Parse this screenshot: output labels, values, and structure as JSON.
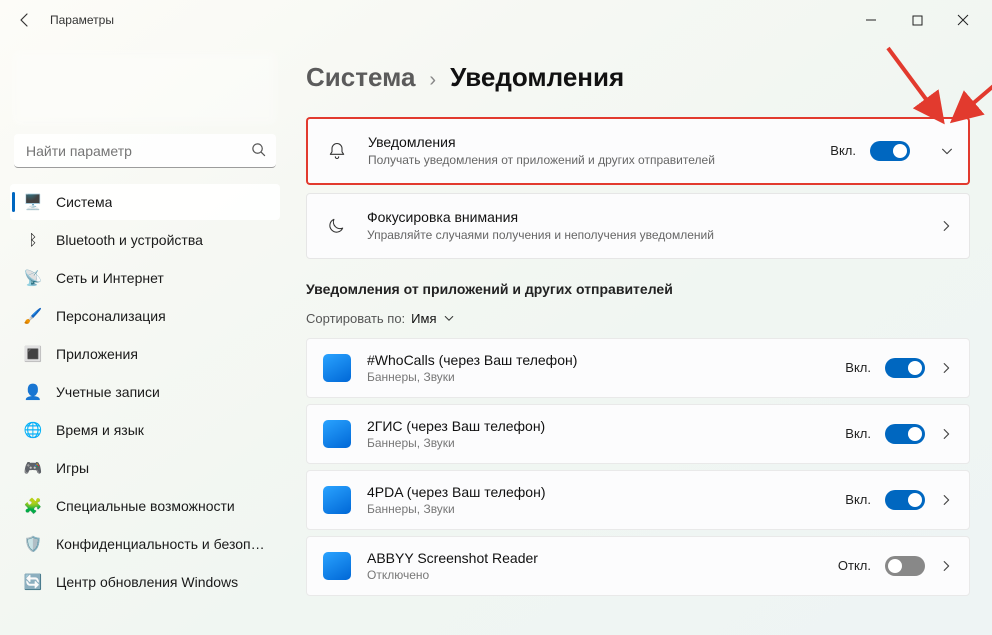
{
  "window": {
    "title": "Параметры"
  },
  "search": {
    "placeholder": "Найти параметр"
  },
  "nav": [
    {
      "icon": "🖥️",
      "label": "Система",
      "selected": true
    },
    {
      "icon": "ᛒ",
      "label": "Bluetooth и устройства"
    },
    {
      "icon": "📡",
      "label": "Сеть и Интернет"
    },
    {
      "icon": "🖌️",
      "label": "Персонализация"
    },
    {
      "icon": "🔳",
      "label": "Приложения"
    },
    {
      "icon": "👤",
      "label": "Учетные записи"
    },
    {
      "icon": "🌐",
      "label": "Время и язык"
    },
    {
      "icon": "🎮",
      "label": "Игры"
    },
    {
      "icon": "🧩",
      "label": "Специальные возможности"
    },
    {
      "icon": "🛡️",
      "label": "Конфиденциальность и безопасность"
    },
    {
      "icon": "🔄",
      "label": "Центр обновления Windows"
    }
  ],
  "breadcrumb": {
    "parent": "Система",
    "sep": "›",
    "current": "Уведомления"
  },
  "notifications_card": {
    "title": "Уведомления",
    "subtitle": "Получать уведомления от приложений и других отправителей",
    "state": "Вкл.",
    "on": true
  },
  "focus_card": {
    "title": "Фокусировка внимания",
    "subtitle": "Управляйте случаями получения и неполучения уведомлений"
  },
  "section_title": "Уведомления от приложений и других отправителей",
  "sort": {
    "label": "Сортировать по:",
    "value": "Имя"
  },
  "apps": [
    {
      "title": "#WhoCalls (через Ваш телефон)",
      "sub": "Баннеры, Звуки",
      "state": "Вкл.",
      "on": true
    },
    {
      "title": "2ГИС (через Ваш телефон)",
      "sub": "Баннеры, Звуки",
      "state": "Вкл.",
      "on": true
    },
    {
      "title": "4PDA (через Ваш телефон)",
      "sub": "Баннеры, Звуки",
      "state": "Вкл.",
      "on": true
    },
    {
      "title": "ABBYY Screenshot Reader",
      "sub": "Отключено",
      "state": "Откл.",
      "on": false
    }
  ]
}
